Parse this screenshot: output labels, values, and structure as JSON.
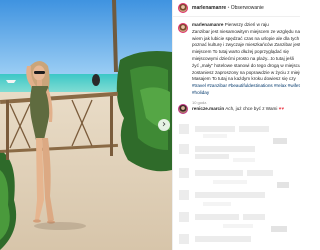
{
  "post": {
    "photo_alt": "",
    "next_label": "›"
  },
  "header": {
    "username": "marlenamanre",
    "separator": " • ",
    "follow_label": "Obserwowanie"
  },
  "caption": {
    "username": "marlenamanre",
    "lines": [
      " Pierwszy dzień w raju",
      "Zanzibar jest niesamowitym miejscem ze względu na l",
      "wiem jak lubicie spędzać czas na urlopie ale dla tych",
      "poznać kulturę i zwyczaje mieszkańców Zanzibar jest",
      "miejscem  To tutaj warto dłużej poprzyglądać się",
      "miejscowymi dziećmi prosto na plaży...to tutaj jeśli",
      "żyć „mały” hotelowe stanowi do tego drogą w miejscu",
      "zostaniesz zaproszony na poprawdzie w życiu z miejscu",
      "Masajem  To tutaj na każdym kroku dowiesz się czy"
    ],
    "tag_line": "#travel #zanzibar #beautifuldestinations #relax #wifeti",
    "tag_line2": "#holiday",
    "time": "10 godz."
  },
  "comment": {
    "username": "renicze.marcin",
    "text": " Ach, już chce być z Wami ",
    "hearts": "♥♥"
  },
  "icons": {
    "avatar_header": "avatar-icon",
    "carousel_next": "chevron-right-icon"
  }
}
